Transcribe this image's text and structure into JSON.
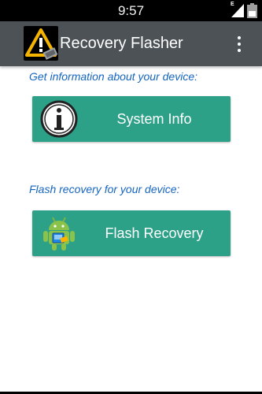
{
  "status_bar": {
    "time": "9:57",
    "network_type": "E",
    "icons": [
      "signal-icon",
      "battery-icon"
    ]
  },
  "app_bar": {
    "title": "Recovery Flasher",
    "logo_icon": "recovery-warning-logo",
    "menu_icon": "overflow-menu-icon",
    "background": "#4d5256"
  },
  "sections": [
    {
      "label": "Get information about your device:",
      "button_label": "System Info",
      "button_icon": "info-icon"
    },
    {
      "label": "Flash recovery for your device:",
      "button_label": "Flash Recovery",
      "button_icon": "android-robot-icon"
    }
  ],
  "colors": {
    "button": "#2ca188",
    "section_label": "#1565c0",
    "status_bar": "#000000"
  }
}
